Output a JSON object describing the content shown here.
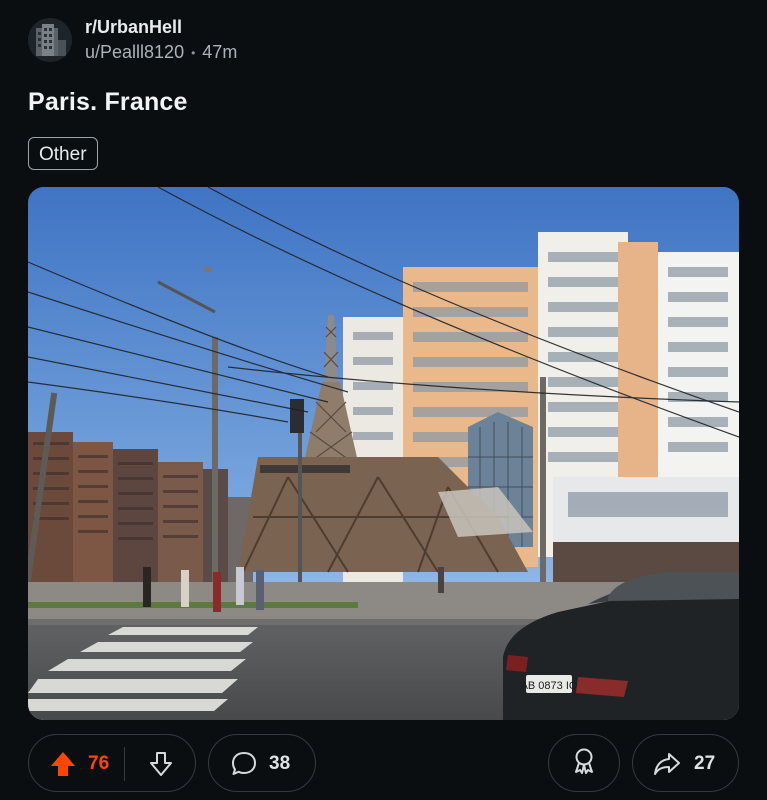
{
  "post": {
    "subreddit": "r/UrbanHell",
    "username": "u/Pealll8120",
    "separator": "•",
    "age": "47m",
    "title": "Paris. France",
    "flair": "Other"
  },
  "image": {
    "description_icon": "photo",
    "license_plate": "AB 0873 IO"
  },
  "actions": {
    "upvotes": "76",
    "comments": "38",
    "shares": "27"
  },
  "colors": {
    "background": "#0b0e11",
    "upvote_accent": "#ff4500",
    "pill_border": "#343a40"
  },
  "icons": [
    "upvote-arrow-icon",
    "downvote-arrow-icon",
    "comment-bubble-icon",
    "award-icon",
    "share-arrow-icon"
  ]
}
